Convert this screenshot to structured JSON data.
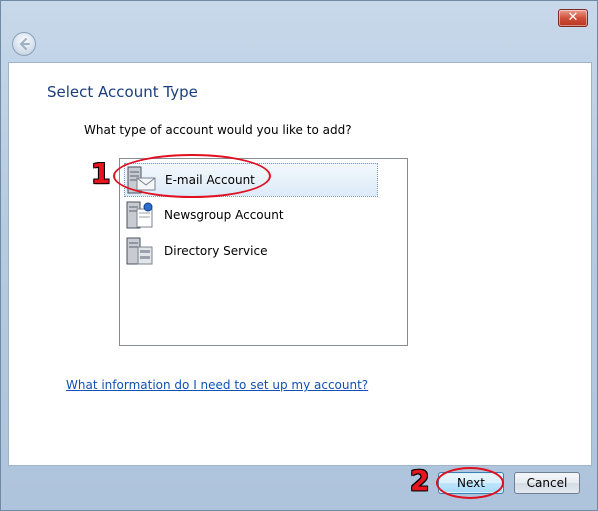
{
  "window": {
    "close_glyph": "✕"
  },
  "page": {
    "heading": "Select Account Type",
    "prompt": "What type of account would you like to add?",
    "help_link": "What information do I need to set up my account?"
  },
  "account_types": [
    {
      "label": "E-mail Account",
      "icon": "email-server-icon",
      "selected": true
    },
    {
      "label": "Newsgroup Account",
      "icon": "newsgroup-server-icon",
      "selected": false
    },
    {
      "label": "Directory Service",
      "icon": "directory-server-icon",
      "selected": false
    }
  ],
  "footer": {
    "next_label": "Next",
    "cancel_label": "Cancel"
  },
  "annotations": {
    "step1": "1",
    "step2": "2",
    "color": "#e8141e"
  }
}
